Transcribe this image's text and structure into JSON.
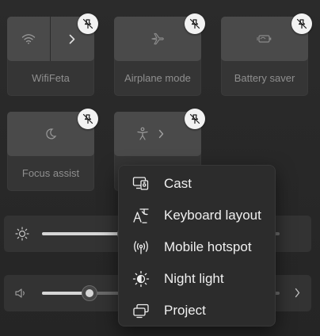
{
  "quick_settings": {
    "tiles": [
      {
        "label": "WifiFeta",
        "icon": "wifi-icon",
        "expandable": true
      },
      {
        "label": "Airplane mode",
        "icon": "airplane-icon",
        "expandable": false
      },
      {
        "label": "Battery saver",
        "icon": "battery-saver-icon",
        "expandable": false
      },
      {
        "label": "Focus assist",
        "icon": "moon-icon",
        "expandable": false
      },
      {
        "label": "",
        "icon": "accessibility-icon",
        "expandable": true
      }
    ],
    "brightness": {
      "icon": "sun-icon",
      "level": 0.35
    },
    "volume": {
      "icon": "speaker-icon",
      "level": 0.2
    }
  },
  "add_menu": {
    "items": [
      {
        "label": "Cast",
        "icon": "cast-icon"
      },
      {
        "label": "Keyboard layout",
        "icon": "keyboard-layout-icon"
      },
      {
        "label": "Mobile hotspot",
        "icon": "hotspot-icon"
      },
      {
        "label": "Night light",
        "icon": "night-light-icon"
      },
      {
        "label": "Project",
        "icon": "project-icon"
      }
    ]
  },
  "colors": {
    "background": "#272727",
    "tile": "#4a4a4a",
    "menu": "#2c2c2c",
    "unpin_badge": "#f2f2f2"
  }
}
